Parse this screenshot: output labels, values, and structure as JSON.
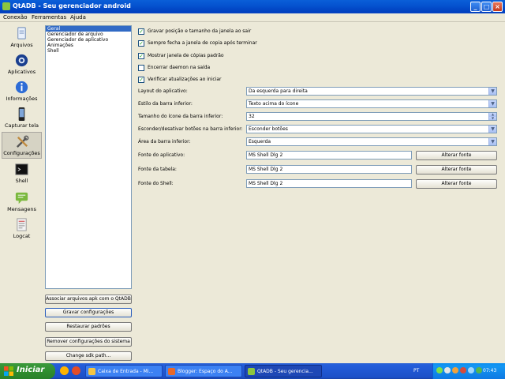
{
  "window": {
    "title": "QtADB - Seu gerenciador android"
  },
  "menu": [
    "Conexão",
    "Ferramentas",
    "Ajuda"
  ],
  "nav": [
    {
      "label": "Arquivos",
      "icon": "file-icon"
    },
    {
      "label": "Aplicativos",
      "icon": "apps-icon"
    },
    {
      "label": "Informações",
      "icon": "info-icon"
    },
    {
      "label": "Capturar tela",
      "icon": "phone-screenshot-icon"
    },
    {
      "label": "Configurações",
      "icon": "tools-icon",
      "active": true
    },
    {
      "label": "Shell",
      "icon": "terminal-icon"
    },
    {
      "label": "Mensagens",
      "icon": "message-icon"
    },
    {
      "label": "Logcat",
      "icon": "log-icon"
    }
  ],
  "categories": [
    "Geral",
    "Gerenciador de arquivo",
    "Gerenciador de aplicativo",
    "Animações",
    "Shell"
  ],
  "selected_category": "Geral",
  "left_buttons": [
    "Associar arquivos apk com o QtADB",
    "Gravar configurações",
    "Restaurar padrões",
    "Remover configurações do sistema",
    "Change sdk path..."
  ],
  "checkboxes": [
    {
      "label": "Gravar posição e tamanho da janela ao sair",
      "checked": true
    },
    {
      "label": "Sempre fecha a janela de copia após terminar",
      "checked": true
    },
    {
      "label": "Mostrar janela de cópias padrão",
      "checked": true
    },
    {
      "label": "Encerrar daemon na saída",
      "checked": false
    },
    {
      "label": "Verificar atualizações ao iniciar",
      "checked": true
    }
  ],
  "settings": {
    "layout": {
      "label": "Layout do aplicativo:",
      "value": "Da esquerda para direita"
    },
    "bar_style": {
      "label": "Estilo da barra inferior:",
      "value": "Texto acima do ícone"
    },
    "icon_size": {
      "label": "Tamanho do ícone da barra inferior:",
      "value": "32"
    },
    "hide_buttons": {
      "label": "Esconder/desativar botões na barra inferior:",
      "value": "Esconder botões"
    },
    "bar_area": {
      "label": "Área da barra inferior:",
      "value": "Esquerda"
    }
  },
  "fonts": [
    {
      "label": "Fonte do aplicativo:",
      "value": "MS Shell Dlg 2",
      "button": "Alterar fonte"
    },
    {
      "label": "Fonte da tabela:",
      "value": "MS Shell Dlg 2",
      "button": "Alterar fonte"
    },
    {
      "label": "Fonte do Shell:",
      "value": "MS Shell Dlg 2",
      "button": "Alterar fonte"
    }
  ],
  "taskbar": {
    "start": "Iniciar",
    "tasks": [
      {
        "label": "Caixa de Entrada - Mi...",
        "active": false
      },
      {
        "label": "Blogger: Espaço do A...",
        "active": false
      },
      {
        "label": "QtADB - Seu gerencia...",
        "active": true
      }
    ],
    "lang": "PT",
    "clock": "07:43"
  },
  "colors": {
    "accent": "#316ac5",
    "titlebar": "#0553d0",
    "taskbar": "#245edb",
    "start": "#2f8e2f"
  }
}
